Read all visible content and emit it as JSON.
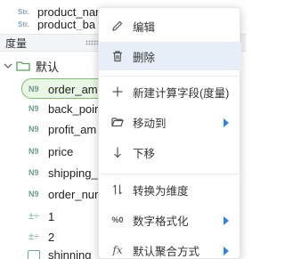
{
  "fields_top": [
    {
      "tag": "Str.",
      "name": "product_name"
    },
    {
      "tag": "Str.",
      "name": "product_ba"
    }
  ],
  "section": {
    "title": "度量"
  },
  "folder": {
    "name": "默认"
  },
  "measures": [
    {
      "tag": "N9",
      "name": "order_am"
    },
    {
      "tag": "N9",
      "name": "back_poir"
    },
    {
      "tag": "N9",
      "name": "profit_am"
    },
    {
      "tag": "N9",
      "name": "price"
    },
    {
      "tag": "N9",
      "name": "shipping_"
    },
    {
      "tag": "N9",
      "name": "order_nur"
    }
  ],
  "formulas": [
    {
      "tag": "±÷",
      "name": "1"
    },
    {
      "tag": "±÷",
      "name": "2"
    }
  ],
  "last_field": {
    "name": "shinning"
  },
  "menu": {
    "edit": "编辑",
    "delete": "删除",
    "new_calc_field": "新建计算字段(度量)",
    "move_to": "移动到",
    "move_down": "下移",
    "convert_dim": "转换为维度",
    "number_format": "数字格式化",
    "default_agg": "默认聚合方式",
    "fx_label": "fx",
    "number_format_icon_text": "%0"
  },
  "colors": {
    "accent": "#2f86e0",
    "highlight": "#e8eef8",
    "selected_border": "#7cbf6b",
    "field_tag": "#6b9a8e"
  }
}
